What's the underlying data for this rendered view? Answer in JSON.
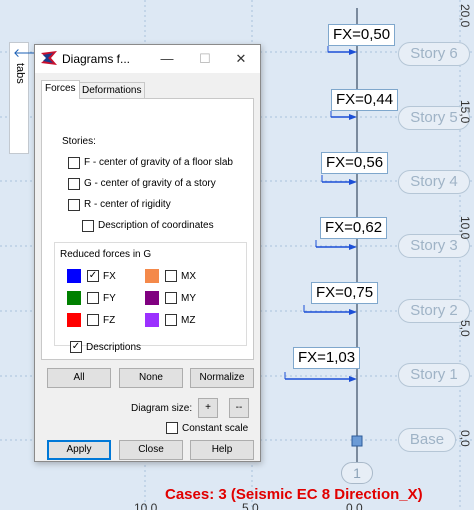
{
  "canvas": {
    "fx_labels": [
      "FX=0,50",
      "FX=0,44",
      "FX=0,56",
      "FX=0,62",
      "FX=0,75",
      "FX=1,03"
    ],
    "stories": [
      "Story 6",
      "Story 5",
      "Story 4",
      "Story 3",
      "Story 2",
      "Story 1",
      "Base"
    ],
    "right_scale": [
      "20,0",
      "15,0",
      "10,0",
      "5,0",
      "0,0"
    ],
    "bottom_scale": [
      "10,0",
      "5,0",
      "0,0"
    ],
    "axis_bubble": "1",
    "cases_text": "Cases: 3 (Seismic EC 8 Direction_X)",
    "colors": {
      "line": "#5a6b80",
      "arrow": "#1c4fd6",
      "grid": "#a9c2dc"
    }
  },
  "tabs_strip": {
    "label": "tabs",
    "arrow": "🡐"
  },
  "dialog": {
    "title": "Diagrams f...",
    "window_buttons": {
      "minimize": "—",
      "maximize": "☐",
      "close": "✕"
    },
    "tabs": [
      {
        "label": "Forces",
        "active": true
      },
      {
        "label": "Deformations",
        "active": false
      }
    ],
    "stories_label": "Stories:",
    "story_options": [
      {
        "label": "F - center of gravity of a floor slab",
        "checked": false
      },
      {
        "label": "G - center of gravity of a story",
        "checked": false
      },
      {
        "label": "R - center of rigidity",
        "checked": false
      },
      {
        "label": "Description of coordinates",
        "checked": false
      }
    ],
    "reduced_forces_label": "Reduced forces in G",
    "forces": [
      {
        "label": "FX",
        "color": "#0000ff",
        "checked": true
      },
      {
        "label": "FY",
        "color": "#008000",
        "checked": false
      },
      {
        "label": "FZ",
        "color": "#ff0000",
        "checked": false
      },
      {
        "label": "MX",
        "color": "#f4894a",
        "checked": false
      },
      {
        "label": "MY",
        "color": "#800080",
        "checked": false
      },
      {
        "label": "MZ",
        "color": "#9b30ff",
        "checked": false
      }
    ],
    "descriptions": {
      "label": "Descriptions",
      "checked": true
    },
    "buttons": {
      "all": "All",
      "none": "None",
      "normalize": "Normalize"
    },
    "diagram_size_label": "Diagram size:",
    "size_plus": "+",
    "size_minus": "--",
    "constant_scale": {
      "label": "Constant scale",
      "checked": false
    },
    "footer": {
      "apply": "Apply",
      "close": "Close",
      "help": "Help"
    }
  }
}
